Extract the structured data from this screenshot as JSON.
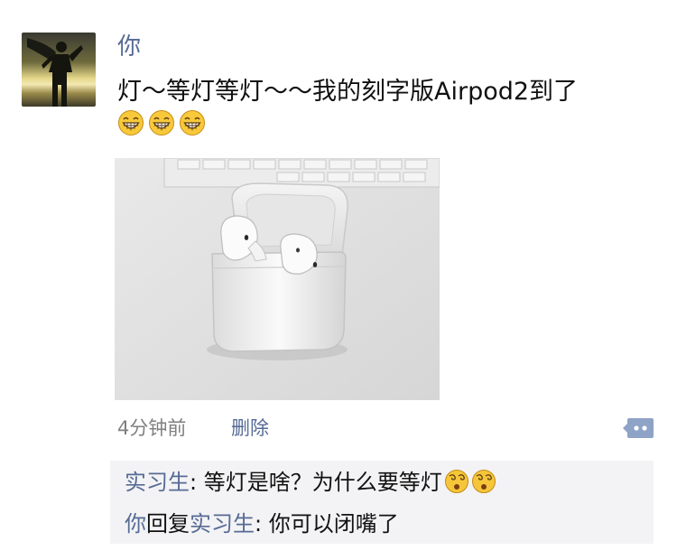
{
  "post": {
    "author": "你",
    "text": "灯～等灯等灯～～我的刻字版Airpod2到了",
    "emojis": [
      "grinning-face-icon",
      "grinning-face-icon",
      "grinning-face-icon"
    ],
    "image": "airpods-charging-case-photo",
    "time": "4分钟前",
    "delete_label": "删除",
    "more_icon": "comment-more-icon"
  },
  "comments": [
    {
      "user": "实习生",
      "separator": ": ",
      "text": "等灯是啥？为什么要等灯",
      "emojis": [
        "dizzy-face-icon",
        "dizzy-face-icon"
      ]
    },
    {
      "user": "你",
      "reply_word": "回复",
      "reply_to": "实习生",
      "separator": ": ",
      "text": "你可以闭嘴了"
    }
  ],
  "colors": {
    "link": "#576b95",
    "text": "#111111",
    "meta": "#7f7f7f",
    "comment_bg": "#f3f3f5"
  }
}
